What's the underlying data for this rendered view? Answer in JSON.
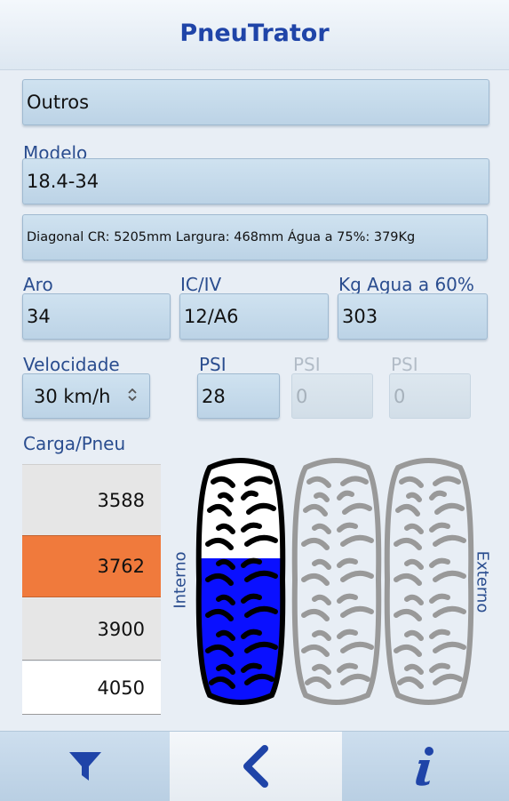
{
  "header": {
    "title": "PneuTrator"
  },
  "brand": {
    "value": "Outros"
  },
  "model": {
    "label": "Modelo",
    "value": "18.4-34"
  },
  "info": {
    "text": "Diagonal CR: 5205mm Largura: 468mm Água a 75%: 379Kg"
  },
  "specs": {
    "aro_label": "Aro",
    "aro_value": "34",
    "iciv_label": "IC/IV",
    "iciv_value": "12/A6",
    "water_label": "Kg Agua a 60%",
    "water_value": "303"
  },
  "speed": {
    "label": "Velocidade",
    "value": "30 km/h"
  },
  "psi": [
    {
      "label": "PSI",
      "value": "28",
      "enabled": true
    },
    {
      "label": "PSI",
      "value": "0",
      "enabled": false
    },
    {
      "label": "PSI",
      "value": "0",
      "enabled": false
    }
  ],
  "load": {
    "label": "Carga/Pneu",
    "options": [
      "3588",
      "3762",
      "3900",
      "4050"
    ],
    "selected": "3762"
  },
  "tires": {
    "inner_label": "Interno",
    "outer_label": "Externo",
    "fill_fraction": 0.6
  },
  "colors": {
    "accent": "#1f44a8",
    "selected_load": "#f07a3c",
    "water": "#0a10ff"
  },
  "nav": {
    "filter_icon": "filter-icon",
    "back_icon": "chevron-left-icon",
    "info_icon": "info-icon"
  }
}
